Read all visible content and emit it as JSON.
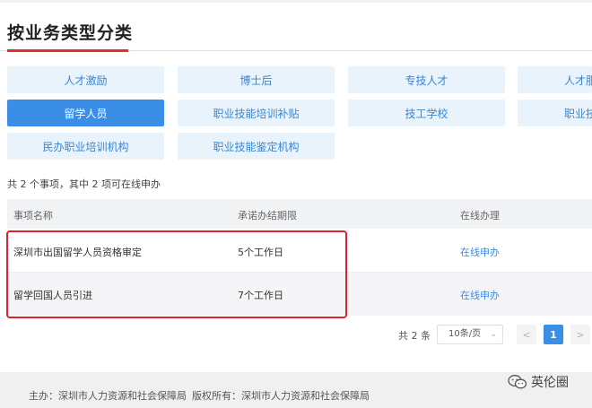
{
  "header": {
    "title": "按业务类型分类"
  },
  "categories": [
    {
      "label": "人才激励"
    },
    {
      "label": "博士后"
    },
    {
      "label": "专技人才"
    },
    {
      "label": "人才服"
    },
    {
      "label": "留学人员",
      "active": true
    },
    {
      "label": "职业技能培训补贴"
    },
    {
      "label": "技工学校"
    },
    {
      "label": "职业技"
    },
    {
      "label": "民办职业培训机构"
    },
    {
      "label": "职业技能鉴定机构"
    }
  ],
  "summary": "共 2 个事项，其中 2 项可在线申办",
  "table": {
    "headers": [
      "事项名称",
      "承诺办结期限",
      "在线办理"
    ],
    "rows": [
      {
        "name": "深圳市出国留学人员资格审定",
        "deadline": "5个工作日",
        "action": "在线申办"
      },
      {
        "name": "留学回国人员引进",
        "deadline": "7个工作日",
        "action": "在线申办"
      }
    ]
  },
  "pagination": {
    "total": "共 2 条",
    "page_size": "10条/页",
    "prev": "<",
    "current": "1",
    "next": ">"
  },
  "footer": {
    "host": "主办：深圳市人力资源和社会保障局",
    "copyright": "版权所有：深圳市人力资源和社会保障局"
  },
  "watermark": {
    "text": "英伦圈",
    "icon": "wechat-icon"
  },
  "colors": {
    "accent": "#3a8ee6",
    "tile": "#e8f3fc",
    "highlight": "#e0202a",
    "title_underline": "#e0312c"
  }
}
